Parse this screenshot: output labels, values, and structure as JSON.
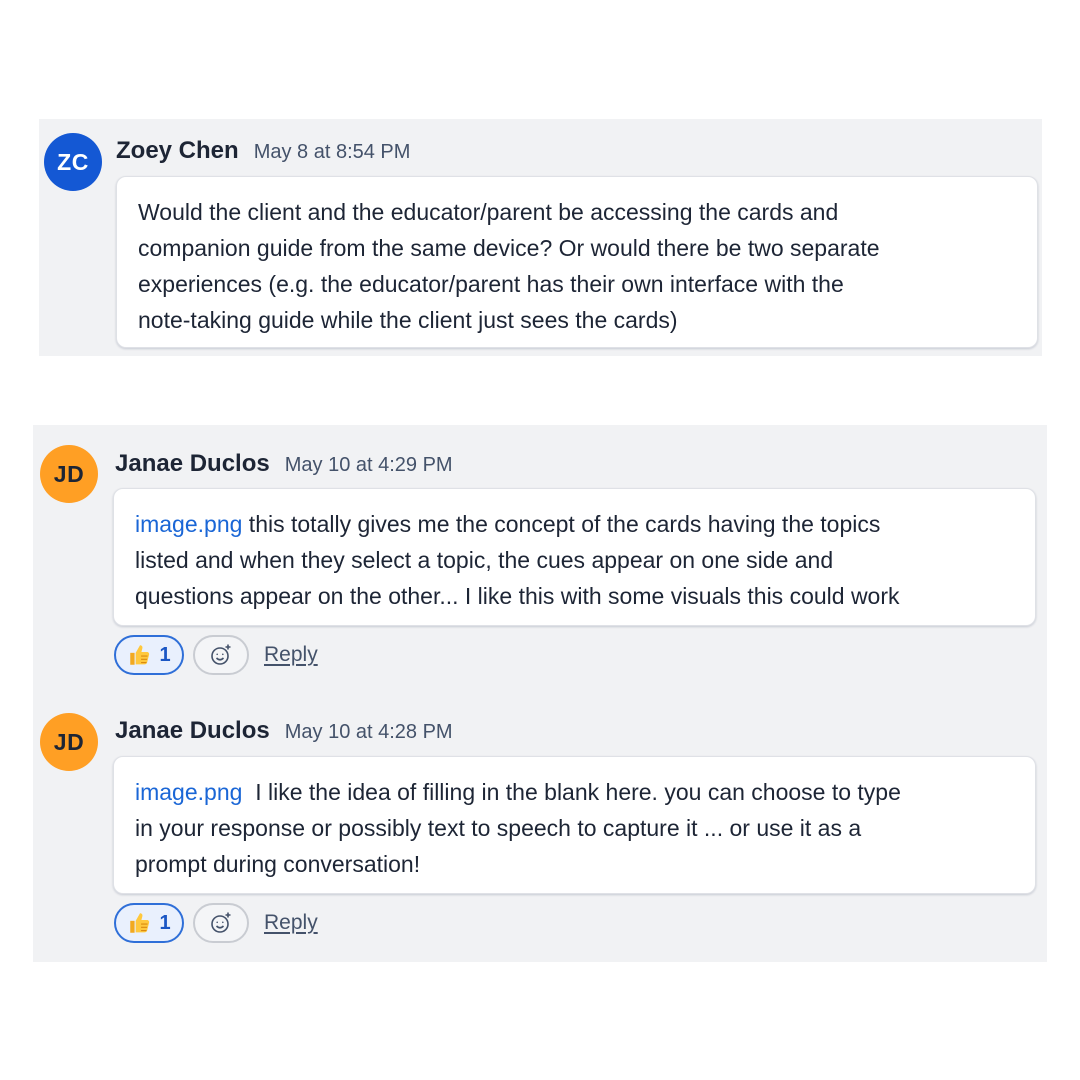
{
  "messages": [
    {
      "author": "Zoey Chen",
      "initials": "ZC",
      "timestamp": "May 8 at 8:54 PM",
      "lines": [
        "Would the client and the educator/parent be accessing the cards and",
        "companion guide from the same device? Or would there be two separate",
        "experiences (e.g. the educator/parent has their own interface with the",
        "note-taking guide while the client just sees the cards)"
      ]
    },
    {
      "author": "Janae Duclos",
      "initials": "JD",
      "timestamp": "May 10 at 4:29 PM",
      "attachment": "image.png",
      "lines": [
        " this totally gives me the concept of the cards having the topics",
        "listed and when they select a topic, the cues appear on one side and",
        "questions appear on the other... I like this with some visuals this could work"
      ],
      "reaction": {
        "emoji": "thumbs-up-icon",
        "count": "1"
      },
      "reply_label": "Reply"
    },
    {
      "author": "Janae Duclos",
      "initials": "JD",
      "timestamp": "May 10 at 4:28 PM",
      "attachment": "image.png",
      "lines": [
        "  I like the idea of filling in the blank here. you can choose to type",
        "in your response or possibly text to speech to capture it ... or use it as a",
        "prompt during conversation!"
      ],
      "reaction": {
        "emoji": "thumbs-up-icon",
        "count": "1"
      },
      "reply_label": "Reply"
    }
  ],
  "colors": {
    "avatar_zc": "#1458d4",
    "avatar_jd": "#ff9f24",
    "link": "#1a66d6",
    "panel_bg": "#f1f2f4",
    "reaction_border": "#2f6fd8"
  }
}
